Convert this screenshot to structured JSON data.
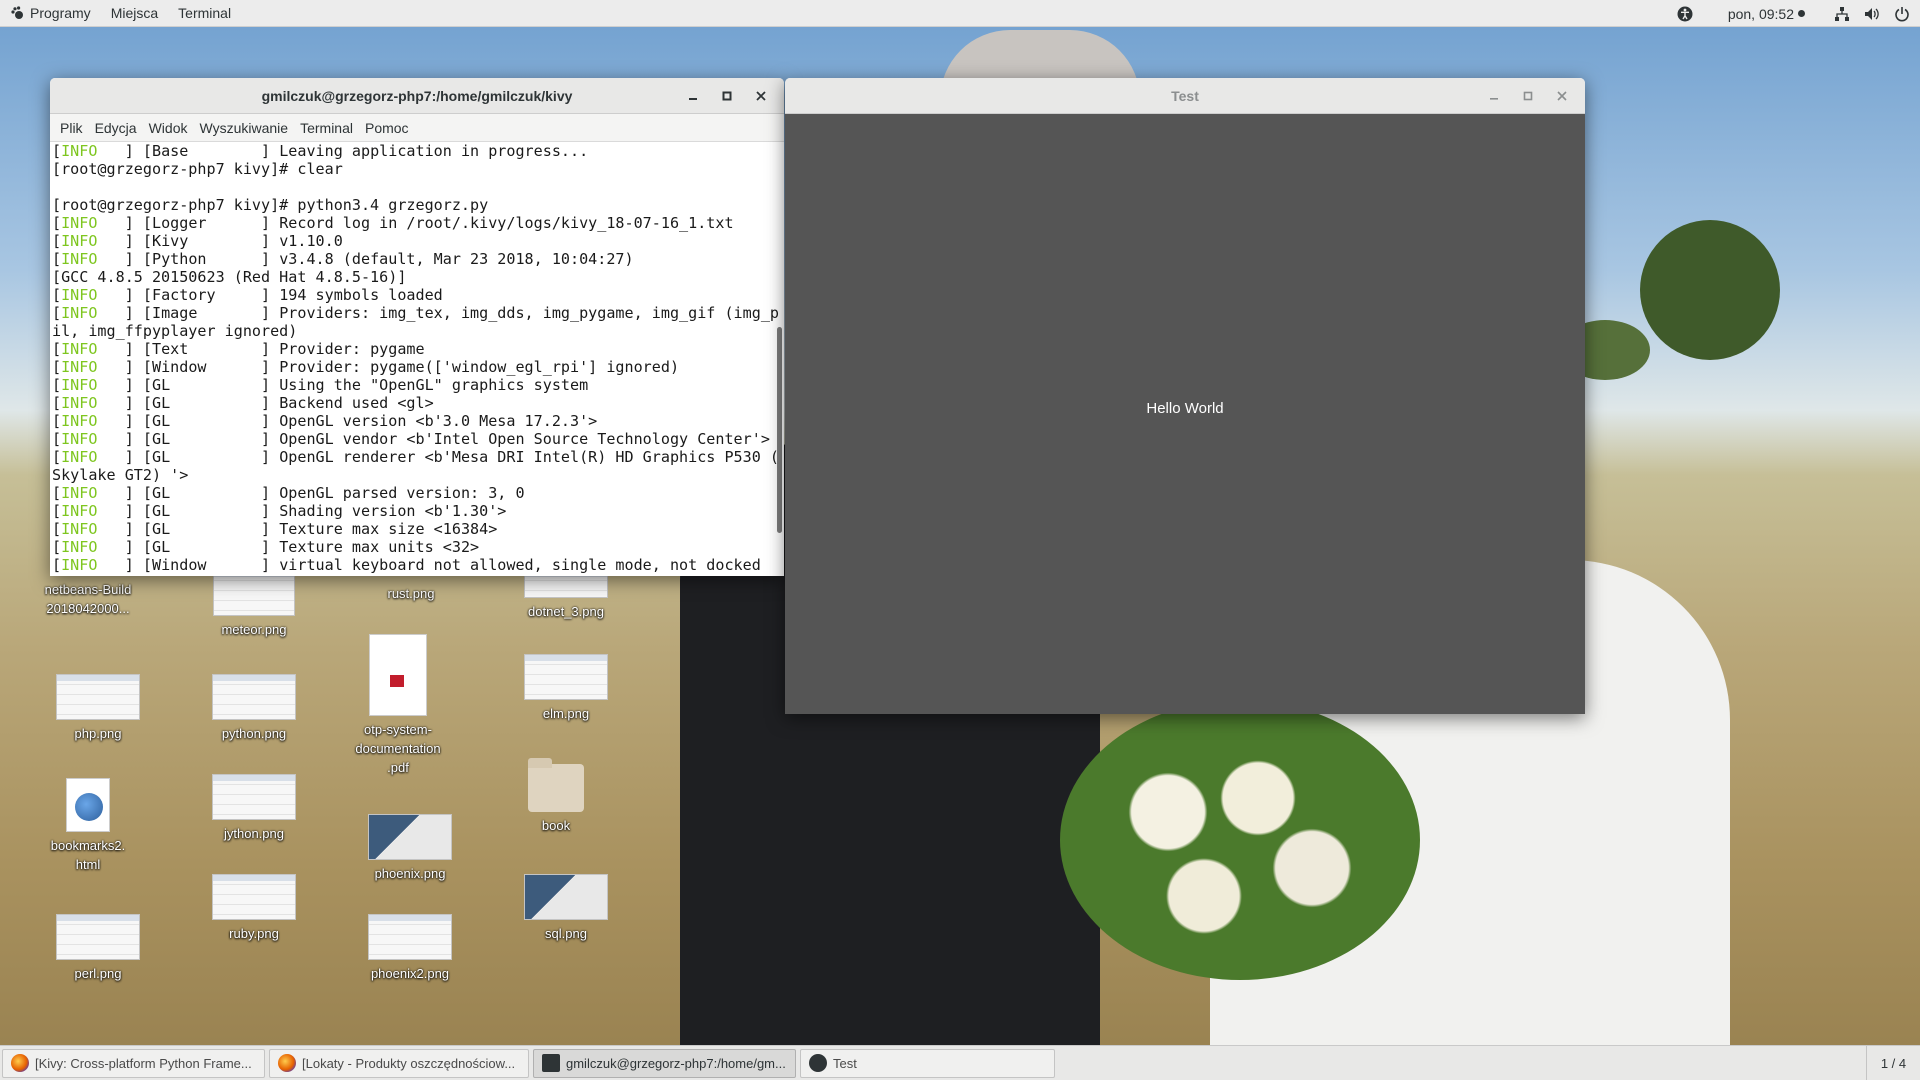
{
  "topbar": {
    "menus": [
      "Programy",
      "Miejsca",
      "Terminal"
    ],
    "clock": "pon, 09:52"
  },
  "desktop_icons": [
    {
      "label": "netbeans-Build 2018042000...",
      "kind": "file"
    },
    {
      "label": "meteor.png",
      "kind": "image"
    },
    {
      "label": "rust.png",
      "kind": "image"
    },
    {
      "label": "dotnet_3.png",
      "kind": "image"
    },
    {
      "label": "php.png",
      "kind": "image"
    },
    {
      "label": "python.png",
      "kind": "image"
    },
    {
      "label": "otp-system-documentation.pdf",
      "kind": "pdf"
    },
    {
      "label": "elm.png",
      "kind": "image"
    },
    {
      "label": "bookmarks2.html",
      "kind": "html"
    },
    {
      "label": "jython.png",
      "kind": "image"
    },
    {
      "label": "phoenix.png",
      "kind": "image"
    },
    {
      "label": "book",
      "kind": "folder"
    },
    {
      "label": "perl.png",
      "kind": "image"
    },
    {
      "label": "ruby.png",
      "kind": "image"
    },
    {
      "label": "phoenix2.png",
      "kind": "image"
    },
    {
      "label": "sql.png",
      "kind": "image"
    }
  ],
  "terminal_window": {
    "title": "gmilczuk@grzegorz-php7:/home/gmilczuk/kivy",
    "menu": [
      "Plik",
      "Edycja",
      "Widok",
      "Wyszukiwanie",
      "Terminal",
      "Pomoc"
    ],
    "lines": [
      {
        "tag": "INFO",
        "text": "   ] [Base        ] Leaving application in progress..."
      },
      {
        "tag": "",
        "text": "[root@grzegorz-php7 kivy]# clear"
      },
      {
        "tag": "",
        "text": ""
      },
      {
        "tag": "",
        "text": "[root@grzegorz-php7 kivy]# python3.4 grzegorz.py"
      },
      {
        "tag": "INFO",
        "text": "   ] [Logger      ] Record log in /root/.kivy/logs/kivy_18-07-16_1.txt"
      },
      {
        "tag": "INFO",
        "text": "   ] [Kivy        ] v1.10.0"
      },
      {
        "tag": "INFO",
        "text": "   ] [Python      ] v3.4.8 (default, Mar 23 2018, 10:04:27)"
      },
      {
        "tag": "",
        "text": "[GCC 4.8.5 20150623 (Red Hat 4.8.5-16)]"
      },
      {
        "tag": "INFO",
        "text": "   ] [Factory     ] 194 symbols loaded"
      },
      {
        "tag": "INFO",
        "text": "   ] [Image       ] Providers: img_tex, img_dds, img_pygame, img_gif (img_p"
      },
      {
        "tag": "",
        "text": "il, img_ffpyplayer ignored)"
      },
      {
        "tag": "INFO",
        "text": "   ] [Text        ] Provider: pygame"
      },
      {
        "tag": "INFO",
        "text": "   ] [Window      ] Provider: pygame(['window_egl_rpi'] ignored)"
      },
      {
        "tag": "INFO",
        "text": "   ] [GL          ] Using the \"OpenGL\" graphics system"
      },
      {
        "tag": "INFO",
        "text": "   ] [GL          ] Backend used <gl>"
      },
      {
        "tag": "INFO",
        "text": "   ] [GL          ] OpenGL version <b'3.0 Mesa 17.2.3'>"
      },
      {
        "tag": "INFO",
        "text": "   ] [GL          ] OpenGL vendor <b'Intel Open Source Technology Center'>"
      },
      {
        "tag": "INFO",
        "text": "   ] [GL          ] OpenGL renderer <b'Mesa DRI Intel(R) HD Graphics P530 ("
      },
      {
        "tag": "",
        "text": "Skylake GT2) '>"
      },
      {
        "tag": "INFO",
        "text": "   ] [GL          ] OpenGL parsed version: 3, 0"
      },
      {
        "tag": "INFO",
        "text": "   ] [GL          ] Shading version <b'1.30'>"
      },
      {
        "tag": "INFO",
        "text": "   ] [GL          ] Texture max size <16384>"
      },
      {
        "tag": "INFO",
        "text": "   ] [GL          ] Texture max units <32>"
      },
      {
        "tag": "INFO",
        "text": "   ] [Window      ] virtual keyboard not allowed, single mode, not docked"
      }
    ]
  },
  "test_window": {
    "title": "Test",
    "label": "Hello World"
  },
  "taskbar": {
    "tasks": [
      {
        "label": "[Kivy: Cross-platform Python Frame...",
        "icon": "firefox-icon"
      },
      {
        "label": "[Lokaty - Produkty oszczędnościow...",
        "icon": "firefox-icon"
      },
      {
        "label": "gmilczuk@grzegorz-php7:/home/gm...",
        "icon": "terminal-icon"
      },
      {
        "label": "Test",
        "icon": "kivy-icon"
      }
    ],
    "workspace": "1 / 4"
  },
  "colors": {
    "info_tag": "#7ec61f",
    "kivy_background": "#555555"
  }
}
